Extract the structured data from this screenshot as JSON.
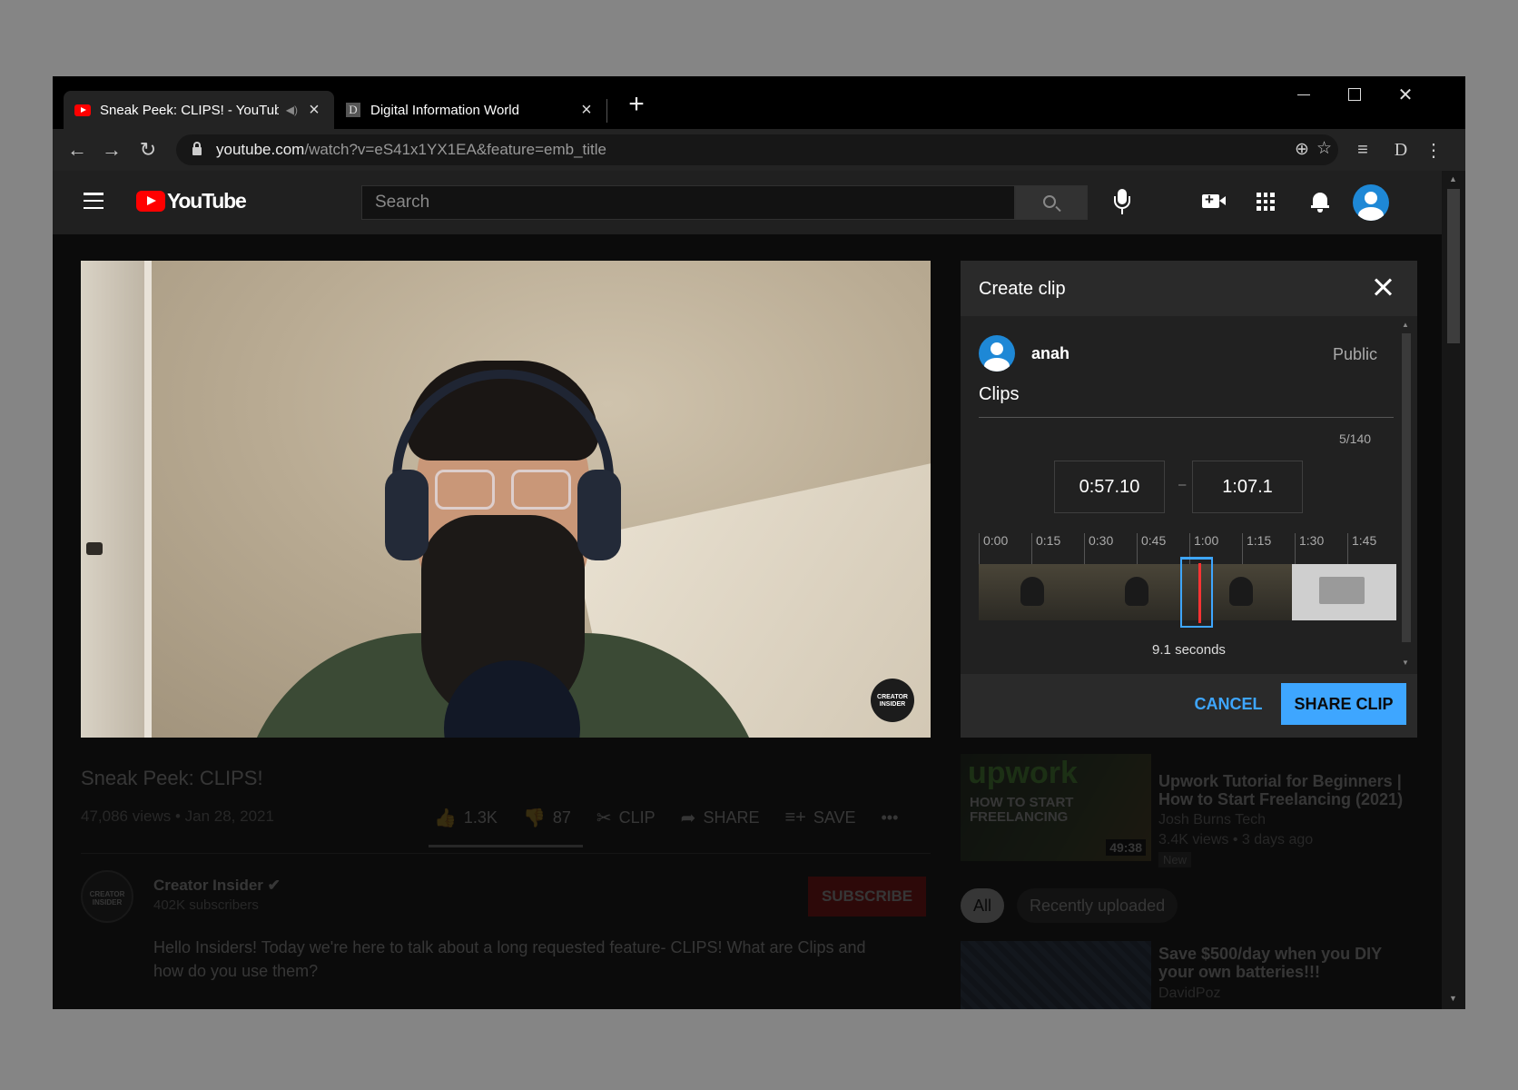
{
  "browser": {
    "tabs": [
      {
        "title": "Sneak Peek: CLIPS! - YouTube"
      },
      {
        "title": "Digital Information World"
      }
    ],
    "second_tab_favicon_letter": "D",
    "new_tab_label": "+",
    "url_host": "youtube.com",
    "url_path": "/watch?v=eS41x1YX1EA&feature=emb_title",
    "profile_letter": "D"
  },
  "masthead": {
    "logo_text": "YouTube",
    "search_placeholder": "Search"
  },
  "video": {
    "badge_text": "CREATOR INSIDER",
    "title": "Sneak Peek: CLIPS!",
    "meta": "47,086 views • Jan 28, 2021",
    "likes": "1.3K",
    "dislikes": "87",
    "clip_label": "CLIP",
    "share_label": "SHARE",
    "save_label": "SAVE",
    "more_label": "•••"
  },
  "channel": {
    "avatar_text": "CREATOR INSIDER",
    "name": "Creator Insider",
    "subscribers": "402K subscribers",
    "subscribe_label": "SUBSCRIBE",
    "description": "Hello Insiders! Today we're here to talk about a long requested feature- CLIPS! What are Clips and how do you use them?"
  },
  "clip_panel": {
    "title": "Create clip",
    "user_name": "anah",
    "visibility": "Public",
    "clip_title": "Clips",
    "char_count": "5/140",
    "start_time": "0:57.10",
    "separator": "–",
    "end_time": "1:07.1",
    "ticks": [
      "0:00",
      "0:15",
      "0:30",
      "0:45",
      "1:00",
      "1:15",
      "1:30",
      "1:45"
    ],
    "duration": "9.1 seconds",
    "cancel_label": "CANCEL",
    "share_label": "SHARE CLIP"
  },
  "recommendations": {
    "item1": {
      "thumb_brand": "upwork",
      "thumb_text": "HOW TO START FREELANCING",
      "duration": "49:38",
      "title": "Upwork Tutorial for Beginners | How to Start Freelancing (2021)",
      "channel": "Josh Burns Tech",
      "meta": "3.4K views • 3 days ago",
      "badge": "New"
    },
    "chips": [
      "All",
      "Recently uploaded"
    ],
    "item2": {
      "title": "Save $500/day when you DIY your own batteries!!!",
      "channel": "DavidPoz"
    }
  },
  "colors": {
    "accent_blue": "#3ea6ff",
    "youtube_red": "#ff0000",
    "panel_bg": "#212121"
  }
}
